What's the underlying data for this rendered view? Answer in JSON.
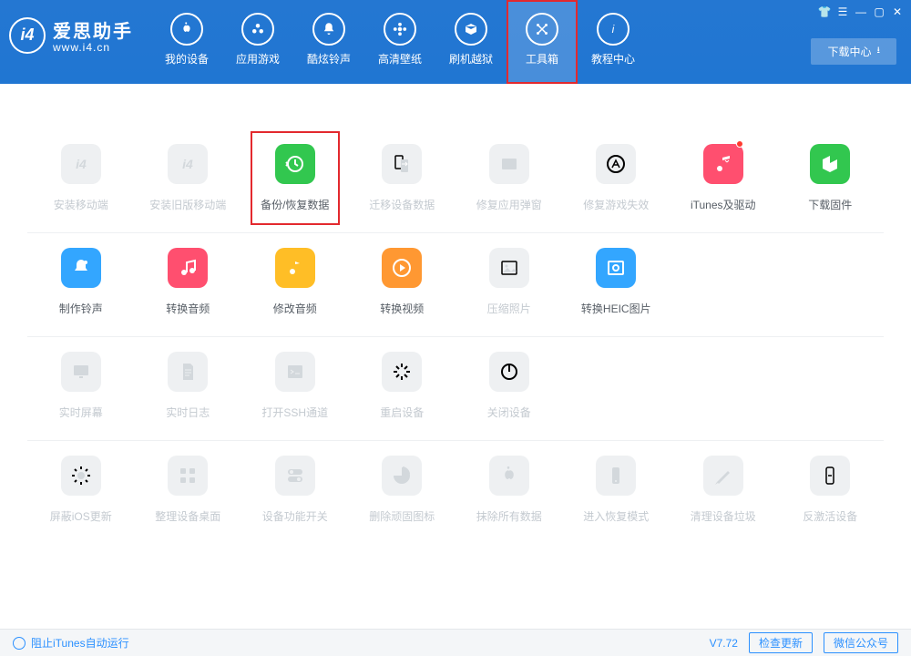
{
  "app": {
    "name": "爱思助手",
    "site": "www.i4.cn"
  },
  "header": {
    "download_center": "下载中心",
    "nav": [
      {
        "id": "device",
        "label": "我的设备",
        "icon": "apple"
      },
      {
        "id": "apps",
        "label": "应用游戏",
        "icon": "apps"
      },
      {
        "id": "ring",
        "label": "酷炫铃声",
        "icon": "bell"
      },
      {
        "id": "wall",
        "label": "高清壁纸",
        "icon": "flower"
      },
      {
        "id": "flash",
        "label": "刷机越狱",
        "icon": "box"
      },
      {
        "id": "tools",
        "label": "工具箱",
        "icon": "tools",
        "selected": true,
        "framed": true
      },
      {
        "id": "help",
        "label": "教程中心",
        "icon": "info"
      }
    ]
  },
  "rows": [
    [
      {
        "id": "install-mobile",
        "label": "安装移动端",
        "icon": "i4",
        "color": "",
        "disabled": true
      },
      {
        "id": "install-old",
        "label": "安装旧版移动端",
        "icon": "i4",
        "color": "",
        "disabled": true
      },
      {
        "id": "backup-restore",
        "label": "备份/恢复数据",
        "icon": "backup",
        "color": "c-green",
        "disabled": false,
        "framed": true
      },
      {
        "id": "migrate",
        "label": "迁移设备数据",
        "icon": "migrate",
        "color": "",
        "disabled": true
      },
      {
        "id": "fix-popup",
        "label": "修复应用弹窗",
        "icon": "popup",
        "color": "",
        "disabled": true
      },
      {
        "id": "fix-game",
        "label": "修复游戏失效",
        "icon": "store",
        "color": "",
        "disabled": true
      },
      {
        "id": "itunes-driver",
        "label": "iTunes及驱动",
        "icon": "music",
        "color": "c-pink",
        "disabled": false,
        "dot": true
      },
      {
        "id": "download-fw",
        "label": "下载固件",
        "icon": "cube",
        "color": "c-green",
        "disabled": false
      }
    ],
    [
      {
        "id": "make-ring",
        "label": "制作铃声",
        "icon": "bell2",
        "color": "c-blue",
        "disabled": false
      },
      {
        "id": "conv-audio",
        "label": "转换音频",
        "icon": "music2",
        "color": "c-pink",
        "disabled": false
      },
      {
        "id": "edit-audio",
        "label": "修改音频",
        "icon": "music3",
        "color": "c-yellow",
        "disabled": false
      },
      {
        "id": "conv-video",
        "label": "转换视频",
        "icon": "play",
        "color": "c-orange",
        "disabled": false
      },
      {
        "id": "compress-img",
        "label": "压缩照片",
        "icon": "image",
        "color": "",
        "disabled": true
      },
      {
        "id": "heic",
        "label": "转换HEIC图片",
        "icon": "heic",
        "color": "c-blue",
        "disabled": false
      },
      {
        "id": "sp1",
        "label": "",
        "icon": "",
        "color": "",
        "spacer": true
      },
      {
        "id": "sp2",
        "label": "",
        "icon": "",
        "color": "",
        "spacer": true
      }
    ],
    [
      {
        "id": "screen",
        "label": "实时屏幕",
        "icon": "monitor",
        "color": "",
        "disabled": true
      },
      {
        "id": "log",
        "label": "实时日志",
        "icon": "doc",
        "color": "",
        "disabled": true
      },
      {
        "id": "ssh",
        "label": "打开SSH通道",
        "icon": "terminal",
        "color": "",
        "disabled": true
      },
      {
        "id": "reboot",
        "label": "重启设备",
        "icon": "loading",
        "color": "",
        "disabled": true
      },
      {
        "id": "shutdown",
        "label": "关闭设备",
        "icon": "power",
        "color": "",
        "disabled": true
      },
      {
        "id": "sp3",
        "label": "",
        "icon": "",
        "spacer": true
      },
      {
        "id": "sp4",
        "label": "",
        "icon": "",
        "spacer": true
      },
      {
        "id": "sp5",
        "label": "",
        "icon": "",
        "spacer": true
      }
    ],
    [
      {
        "id": "block-ios",
        "label": "屏蔽iOS更新",
        "icon": "gear",
        "color": "",
        "disabled": true
      },
      {
        "id": "desktop",
        "label": "整理设备桌面",
        "icon": "grid",
        "color": "",
        "disabled": true
      },
      {
        "id": "switches",
        "label": "设备功能开关",
        "icon": "toggles",
        "color": "",
        "disabled": true
      },
      {
        "id": "del-icons",
        "label": "删除顽固图标",
        "icon": "pie",
        "color": "",
        "disabled": true
      },
      {
        "id": "erase",
        "label": "抹除所有数据",
        "icon": "apple2",
        "color": "",
        "disabled": true
      },
      {
        "id": "recovery",
        "label": "进入恢复模式",
        "icon": "phone",
        "color": "",
        "disabled": true
      },
      {
        "id": "clean",
        "label": "清理设备垃圾",
        "icon": "brush",
        "color": "",
        "disabled": true
      },
      {
        "id": "deactivate",
        "label": "反激活设备",
        "icon": "phone2",
        "color": "",
        "disabled": true
      }
    ]
  ],
  "footer": {
    "itunes_block": "阻止iTunes自动运行",
    "version": "V7.72",
    "check_update": "检查更新",
    "wechat": "微信公众号"
  }
}
